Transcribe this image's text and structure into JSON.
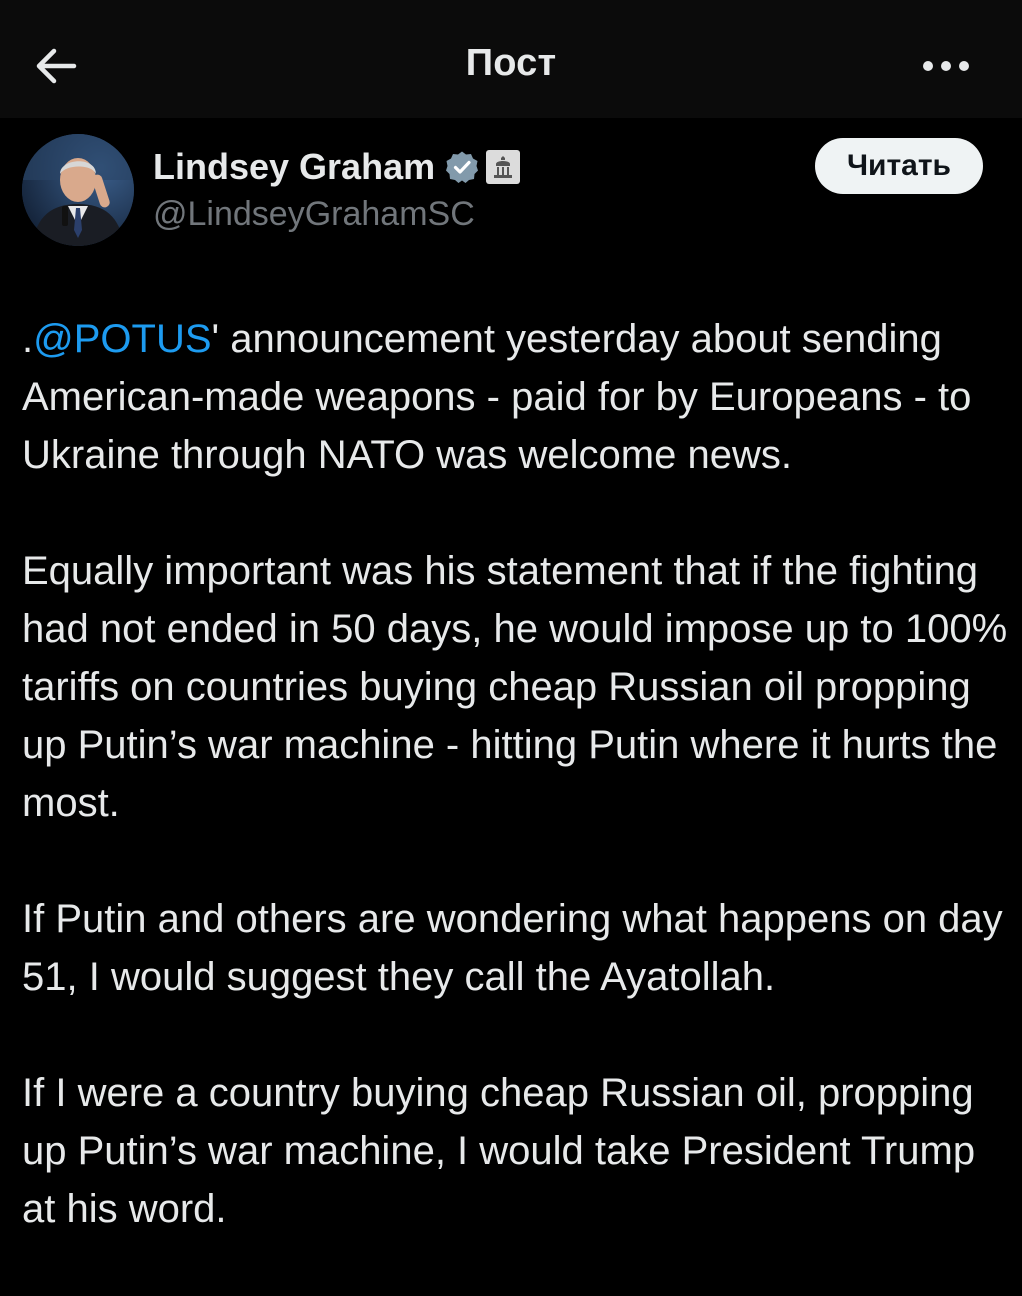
{
  "header": {
    "title": "Пост",
    "back_icon": "arrow-left-icon",
    "more_icon": "more-horizontal-icon"
  },
  "author": {
    "name": "Lindsey Graham",
    "handle": "@LindseyGrahamSC",
    "badges": [
      "verified-icon",
      "government-building-icon"
    ],
    "verified_color": "#829aab"
  },
  "follow_button": {
    "label": "Читать"
  },
  "post": {
    "paragraphs": [
      {
        "prefix": ".",
        "mention": "@POTUS",
        "text": "' announcement yesterday about sending American-made weapons  - paid for by Europeans - to Ukraine through NATO was welcome news."
      },
      {
        "text": "Equally important was his statement that if the fighting had not ended in 50 days, he would impose up to 100% tariffs on countries buying cheap Russian oil propping up Putin’s war machine - hitting Putin where it hurts the most."
      },
      {
        "text": "If Putin and others are wondering what happens on day 51, I would suggest they call the Ayatollah."
      },
      {
        "text": "If I were a country buying cheap Russian oil, propping up Putin’s war machine, I would take President Trump at his word."
      }
    ]
  },
  "colors": {
    "background": "#000000",
    "header_background": "#0b0b0b",
    "text": "#e7e9ea",
    "secondary_text": "#71767b",
    "link": "#1d9bf0",
    "button_background": "#eff3f4"
  }
}
